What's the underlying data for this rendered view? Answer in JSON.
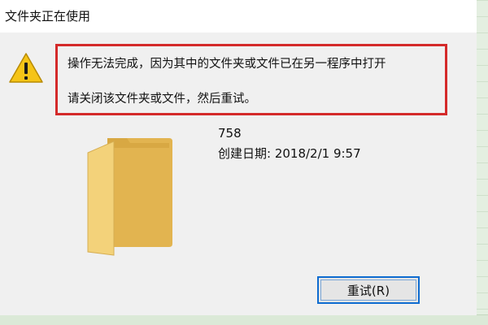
{
  "dialog": {
    "title": "文件夹正在使用",
    "message_line1": "操作无法完成，因为其中的文件夹或文件已在另一程序中打开",
    "message_line2": "请关闭该文件夹或文件，然后重试。",
    "warning_icon": "warning-triangle-icon",
    "folder_icon": "folder-icon",
    "file": {
      "name": "758",
      "created": "创建日期: 2018/2/1 9:57"
    },
    "retry_button_label": "重试(R)"
  },
  "colors": {
    "highlight_border": "#d42a2a",
    "button_focus": "#0f6cd0",
    "warning_fill": "#f5c417",
    "folder_fill": "#f3d27a",
    "background_grid": "#e4efe1"
  }
}
